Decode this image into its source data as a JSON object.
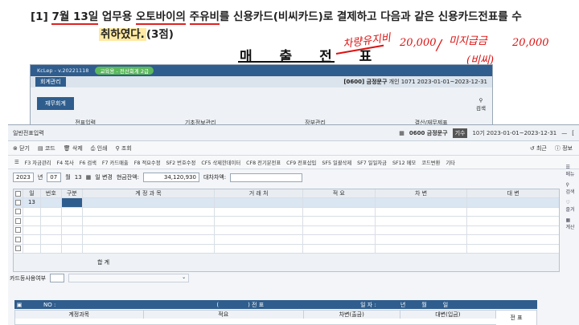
{
  "question": {
    "num": "[1]",
    "date": "7월 13일",
    "part1": "업무용",
    "bike": "오토바이의",
    "fuel": "주유비",
    "part2": "를 신용카드(비씨카드)로 결제하고 다음과 같은 신용카드전표를 수",
    "part3": "취하였다.",
    "points": "(3점)"
  },
  "slip_title": "매 출 전 표",
  "handwriting": {
    "a": "차량유지비",
    "b": "20,000",
    "c": "/",
    "d": "미지급금",
    "e": "20,000",
    "f": "(비씨)"
  },
  "bg_window": {
    "app": "KcLep - v.20221118",
    "edu": "교육용 - 전산회계 2급",
    "tab": "회계관리",
    "company": "[0600] 금정문구",
    "company_info": "개인 1071 2023-01-01~2023-12-31",
    "menu": "재무회계",
    "search_label": "검색",
    "items": [
      "전표입력",
      "기초정보관리",
      "장부관리",
      "결산/재무제표"
    ]
  },
  "main": {
    "title": "일반전표입력",
    "company": "0600 금정문구",
    "badge": "기수",
    "period": "10기 2023-01-01~2023-12-31",
    "toolbar1": [
      "닫기",
      "코드",
      "삭제",
      "인쇄",
      "조회"
    ],
    "toolbar1_right": [
      "최근",
      "정보"
    ],
    "toolbar2": [
      "F3 자금관리",
      "F4 복사",
      "F6 검색",
      "F7 카드매출",
      "F8 적요수정",
      "SF2 번호수정",
      "CF5 삭제한데이터",
      "CF8 전기분전표",
      "CF9 전표삽입",
      "SF5 일괄삭제",
      "SF7 일일자금",
      "SF12 메모",
      "코드변환",
      "기타"
    ],
    "filter": {
      "year": "2023",
      "year_label": "년",
      "month": "07",
      "month_label": "월",
      "day": "13",
      "day_label": "일 변경",
      "cash_label": "현금잔액:",
      "cash": "34,120,930",
      "diff_label": "대차차액:"
    },
    "columns": [
      "일",
      "번호",
      "구분",
      "계 정 과 목",
      "거 래 처",
      "적 요",
      "차 변",
      "대 변"
    ],
    "rows": [
      {
        "day": "13"
      },
      {},
      {},
      {},
      {},
      {}
    ],
    "total_label": "합 계",
    "card_label": "카드등사용여부",
    "slip": {
      "no_label": "NO :",
      "paren": "(",
      "paren_close": ") 전 표",
      "date_label": "일 자 :",
      "y": "년",
      "m": "월",
      "d": "일"
    },
    "slip_cols": [
      "계정과목",
      "적요",
      "차변(출금)",
      "대변(입금)"
    ],
    "slip_right": "전 표"
  },
  "sidebar": [
    "메뉴",
    "검색",
    "즐겨",
    "계산"
  ]
}
